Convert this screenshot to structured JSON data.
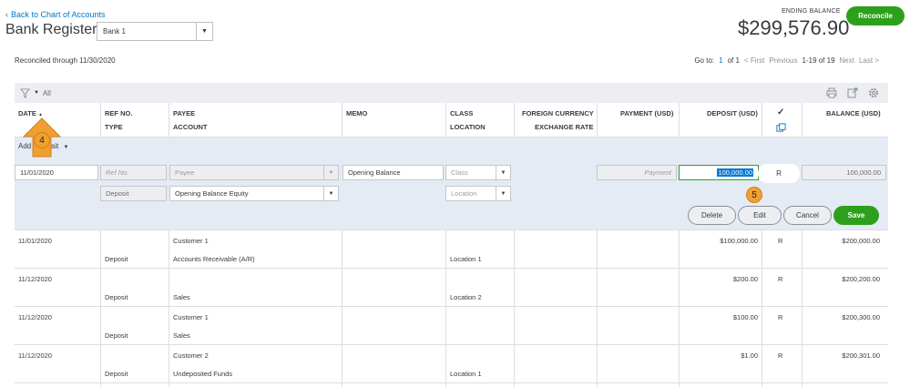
{
  "header": {
    "back_link": "Back to Chart of Accounts",
    "title": "Bank Register",
    "account": "Bank 1",
    "ending_balance_label": "ENDING BALANCE",
    "ending_balance": "$299,576.90",
    "reconcile_label": "Reconcile"
  },
  "status": {
    "reconciled_text": "Reconciled through 11/30/2020"
  },
  "pager": {
    "goto_label": "Go to:",
    "page": "1",
    "of_text": "of 1",
    "first": "< First",
    "previous": "Previous",
    "range": "1-19 of 19",
    "next": "Next",
    "last": "Last >"
  },
  "toolbar": {
    "filter_label": "All",
    "icons": [
      "print-icon",
      "export-icon",
      "settings-icon"
    ]
  },
  "columns": {
    "date": "DATE",
    "ref_no": "REF NO.",
    "type": "TYPE",
    "payee": "PAYEE",
    "account": "ACCOUNT",
    "memo": "MEMO",
    "class": "CLASS",
    "location": "LOCATION",
    "foreign_currency": "FOREIGN CURRENCY",
    "exchange_rate": "EXCHANGE RATE",
    "payment": "PAYMENT (USD)",
    "deposit": "DEPOSIT (USD)",
    "check": "✓",
    "balance": "BALANCE (USD)"
  },
  "add_row": {
    "label_prefix": "Add",
    "label_suffix": "sit"
  },
  "edit_row": {
    "date": "11/01/2020",
    "ref_placeholder": "Ref No.",
    "payee_placeholder": "Payee",
    "memo": "Opening Balance",
    "class_placeholder": "Class",
    "payment_placeholder": "Payment",
    "deposit": "100,000.00",
    "reconcile_status": "R",
    "balance": "100,000.00",
    "type": "Deposit",
    "account": "Opening Balance Equity",
    "location_placeholder": "Location",
    "delete_label": "Delete",
    "edit_label": "Edit",
    "cancel_label": "Cancel",
    "save_label": "Save"
  },
  "callouts": {
    "step4": "4",
    "step5": "5"
  },
  "transactions": [
    {
      "date": "11/01/2020",
      "type": "Deposit",
      "payee": "Customer 1",
      "account": "Accounts Receivable (A/R)",
      "location": "Location 1",
      "deposit": "$100,000.00",
      "status": "R",
      "balance": "$200,000.00"
    },
    {
      "date": "11/12/2020",
      "type": "Deposit",
      "payee": "",
      "account": "Sales",
      "location": "Location 2",
      "deposit": "$200.00",
      "status": "R",
      "balance": "$200,200.00"
    },
    {
      "date": "11/12/2020",
      "type": "Deposit",
      "payee": "Customer 1",
      "account": "Sales",
      "location": "",
      "deposit": "$100.00",
      "status": "R",
      "balance": "$200,300.00"
    },
    {
      "date": "11/12/2020",
      "type": "Deposit",
      "payee": "Customer 2",
      "account": "Undeposited Funds",
      "location": "Location 1",
      "deposit": "$1.00",
      "status": "R",
      "balance": "$200,301.00"
    }
  ]
}
